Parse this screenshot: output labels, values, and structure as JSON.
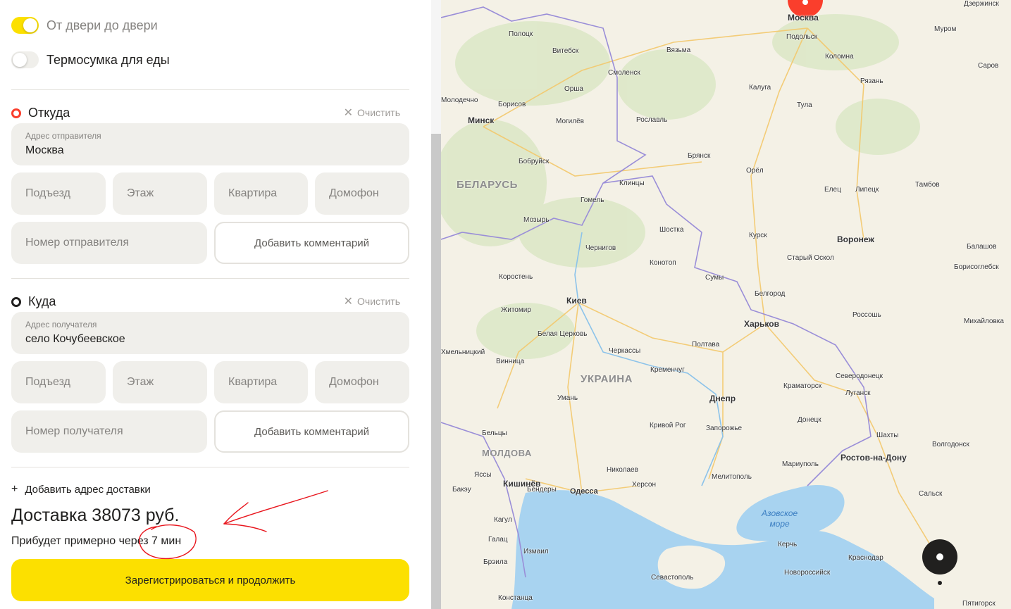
{
  "options": {
    "door_to_door": {
      "label": "От двери до двери",
      "enabled": true
    },
    "thermo_bag": {
      "label": "Термосумка для еды",
      "enabled": false
    }
  },
  "from": {
    "title": "Откуда",
    "clear_label": "Очистить",
    "address_label": "Адрес отправителя",
    "address_value": "Москва",
    "entrance_placeholder": "Подъезд",
    "floor_placeholder": "Этаж",
    "apartment_placeholder": "Квартира",
    "intercom_placeholder": "Домофон",
    "phone_placeholder": "Номер отправителя",
    "comment_button": "Добавить комментарий"
  },
  "to": {
    "title": "Куда",
    "clear_label": "Очистить",
    "address_label": "Адрес получателя",
    "address_value": "село Кочубеевское",
    "entrance_placeholder": "Подъезд",
    "floor_placeholder": "Этаж",
    "apartment_placeholder": "Квартира",
    "intercom_placeholder": "Домофон",
    "phone_placeholder": "Номер получателя",
    "comment_button": "Добавить комментарий"
  },
  "add_address_label": "Добавить адрес доставки",
  "price_text": "Доставка 38073 руб.",
  "eta_text": "Прибудет примерно через 7 мин",
  "cta_label": "Зарегистрироваться и продолжить",
  "colors": {
    "accent": "#fce000",
    "from_marker": "#fa3e2c",
    "annotation": "#e8141c"
  },
  "map": {
    "countries": [
      "БЕЛАРУСЬ",
      "УКРАИНА",
      "МОЛДОВА"
    ],
    "sea": "Азовское\nморе",
    "cities_big": [
      "Москва",
      "Минск",
      "Киев",
      "Харьков",
      "Кишинёв",
      "Воронеж",
      "Днепр",
      "Ростов-на-Дону"
    ],
    "cities": [
      "Подольск",
      "Витебск",
      "Смоленск",
      "Калуга",
      "Тула",
      "Рязань",
      "Коломна",
      "Вязьма",
      "Полоцк",
      "Орша",
      "Борисов",
      "Могилёв",
      "Рославль",
      "Брянск",
      "Бобруйск",
      "Орёл",
      "Гомель",
      "Клинцы",
      "Липецк",
      "Тамбов",
      "Елец",
      "Мозырь",
      "Шостка",
      "Курск",
      "Чернигов",
      "Конотоп",
      "Старый Оскол",
      "Сумы",
      "Белгород",
      "Коростень",
      "Житомир",
      "Белая Церковь",
      "Черкассы",
      "Полтава",
      "Кременчуг",
      "Винница",
      "Хмельницкий",
      "Умань",
      "Краматорск",
      "Северодонецк",
      "Луганск",
      "Кривой Рог",
      "Запорожье",
      "Донецк",
      "Бельцы",
      "Николаев",
      "Херсон",
      "Мелитополь",
      "Мариуполь",
      "Одесса",
      "Бендеры",
      "Шахты",
      "Волгодонск",
      "Сальск",
      "Кагул",
      "Галац",
      "Брэила",
      "Измаил",
      "Керчь",
      "Краснодар",
      "Новороссийск",
      "Севастополь",
      "Констанца",
      "Пятигорск",
      "Муром",
      "Саров",
      "Дзержинск",
      "Балашов",
      "Борисоглебск",
      "Россошь",
      "Михайловка",
      "Ясcы",
      "Молодечно",
      "Бакэу"
    ]
  }
}
